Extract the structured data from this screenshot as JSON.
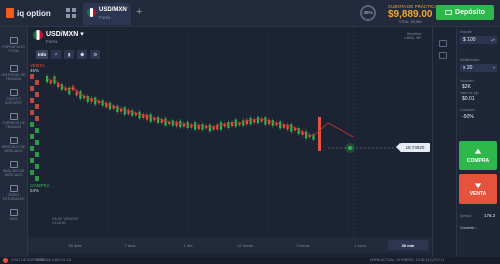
{
  "app": {
    "logo_text": "iq option"
  },
  "tab": {
    "symbol": "USD/MXN",
    "subtitle": "Forex",
    "close": "×"
  },
  "header": {
    "plus": "+",
    "percent": "45%",
    "account_label": "CUENTA DE PRÁCTICA",
    "balance": "$9,889.00",
    "balance_sub": "TOTAL: $9,889",
    "deposit_label": "Depósito"
  },
  "sidebar": {
    "items": [
      {
        "label": "PORTAFOLIO TOTAL",
        "icon": "briefcase-icon"
      },
      {
        "label": "HISTORIAL DE TRADING",
        "icon": "history-icon"
      },
      {
        "label": "CHATS Y SOPORTE",
        "icon": "chat-icon"
      },
      {
        "label": "TORNEOS DE TRADING",
        "icon": "trophy-icon"
      },
      {
        "label": "MERCADO DE MERCADO",
        "icon": "market-icon"
      },
      {
        "label": "ANÁLISIS DE MERCADO",
        "icon": "analysis-icon"
      },
      {
        "label": "VIDEO TUTORIALES",
        "icon": "video-icon"
      },
      {
        "label": "MÁS",
        "icon": "more-icon"
      }
    ]
  },
  "chart_header": {
    "symbol": "USD/MXN",
    "dropdown": "▾",
    "subtitle": "Forex"
  },
  "tools": {
    "info": "Info",
    "t2": "ᵖ",
    "t3": "▮",
    "t4": "⬟",
    "t5": "⚙"
  },
  "sentiment": {
    "sell_label": "VENTA",
    "sell_pct": "46%",
    "buy_label": "COMPRA",
    "buy_pct": "54%",
    "top_note_1": "Beneficio",
    "top_note_2": "LABEL INF"
  },
  "price_tag": "18.74920",
  "expiry_label_1": "HA DE VENCER",
  "expiry_label_2": "13:15:00",
  "timeframes": [
    "30 días",
    "7 días",
    "1 día",
    "12 horas",
    "3 horas",
    "1 hora",
    "30 min"
  ],
  "right_panel": {
    "amount_label": "Importe",
    "amount_value": "$ 100",
    "multiplier_label": "Multiplicador",
    "multiplier_value": "x 20",
    "volume_label": "Volumen",
    "volume_value": "$2K",
    "pip_label": "Valor de pip",
    "pip_value": "$0.01",
    "profit_label": "Comisión",
    "profit_value": "-50%",
    "buy_label": "COMPRA",
    "sell_label": "VENTA",
    "spread_label": "Spread",
    "spread_value": "176.2",
    "convert_label": "Convertir ↓"
  },
  "footer": {
    "support": "CHAT DE SOPORTE",
    "phone": "CANADA 1-800-01-C8",
    "time": "HORA ACTUAL: 29 ENERO, 13:06:13 (UTC+1)"
  },
  "colors": {
    "up": "#2eb84c",
    "down": "#e5533d",
    "accent": "#f0a830",
    "bg": "#1c2333"
  }
}
